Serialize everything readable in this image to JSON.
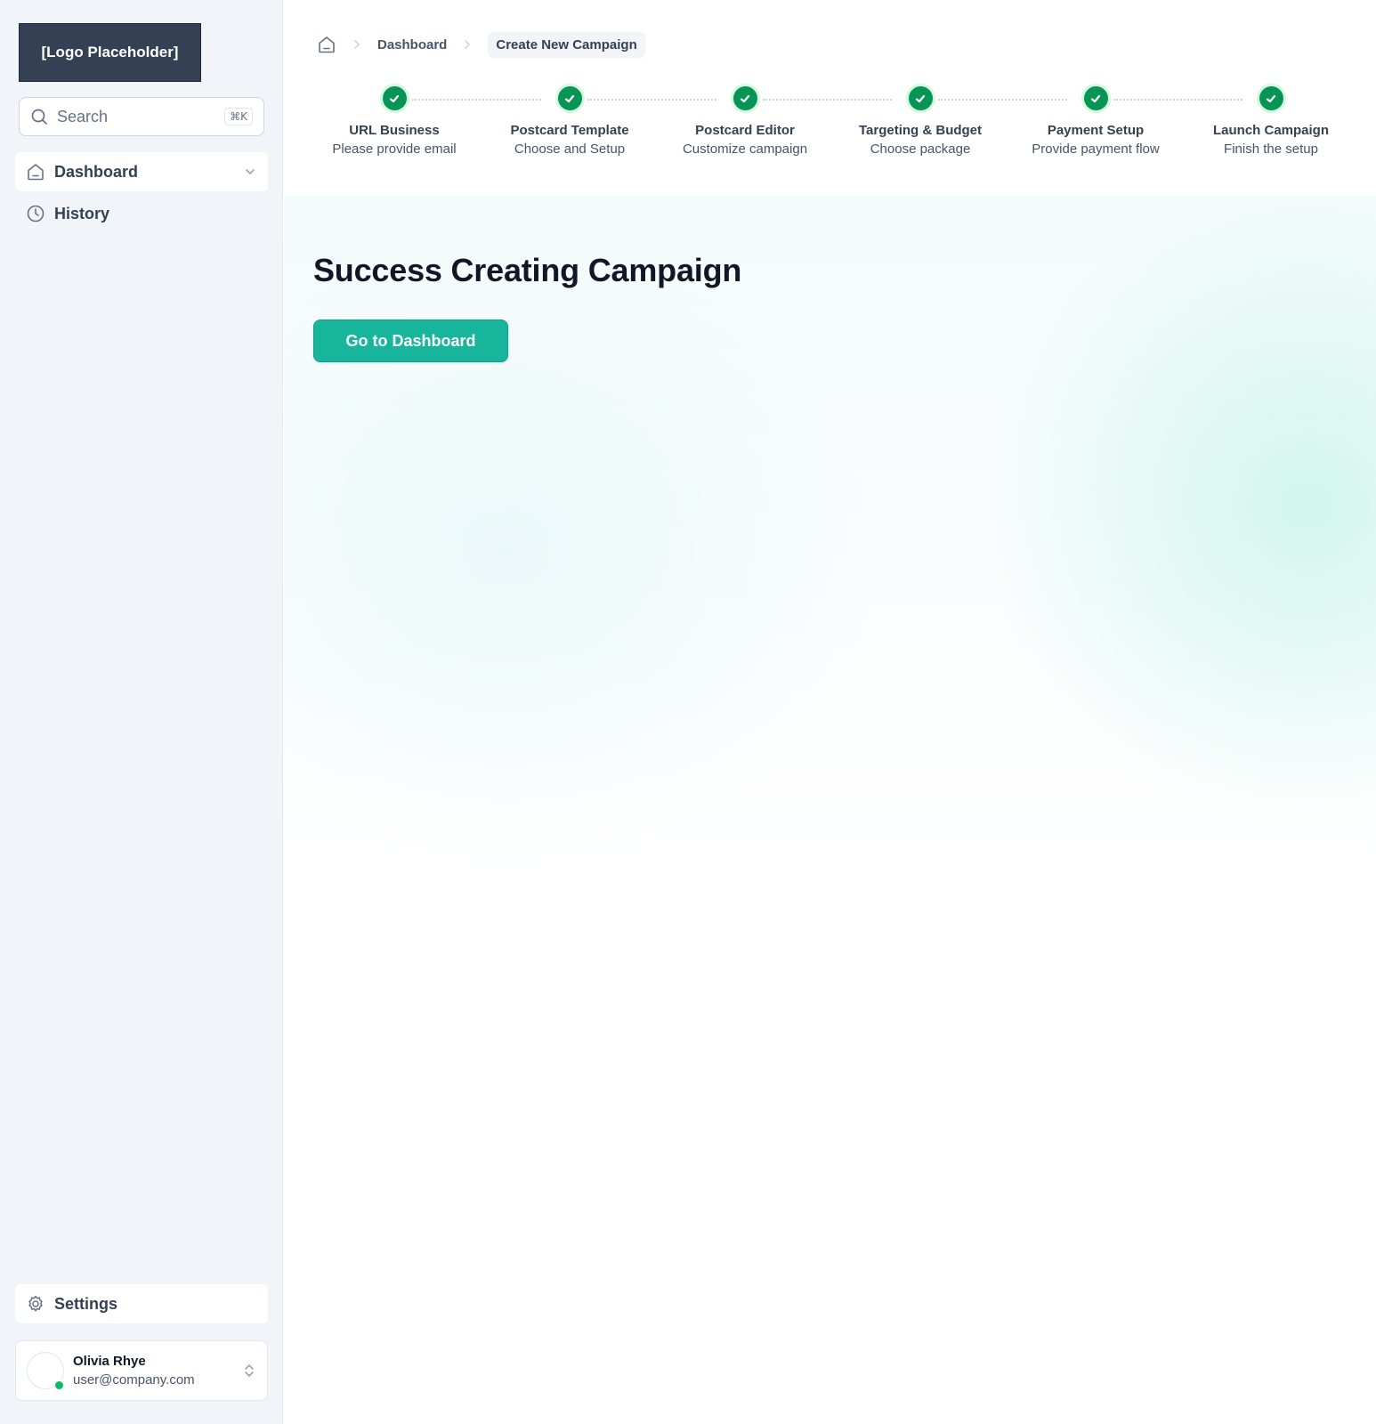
{
  "sidebar": {
    "logo_text": "[Logo Placeholder]",
    "search": {
      "placeholder": "Search",
      "shortcut": "⌘K"
    },
    "nav": [
      {
        "label": "Dashboard",
        "icon": "home-icon",
        "active": true,
        "expandable": true
      },
      {
        "label": "History",
        "icon": "clock-icon",
        "active": false
      }
    ],
    "settings_label": "Settings",
    "user": {
      "name": "Olivia Rhye",
      "email": "user@company.com",
      "status": "online"
    }
  },
  "breadcrumb": {
    "items": [
      "Dashboard",
      "Create New Campaign"
    ]
  },
  "stepper": {
    "steps": [
      {
        "title": "URL Business",
        "subtitle": "Please provide email",
        "status": "complete"
      },
      {
        "title": "Postcard Template",
        "subtitle": "Choose and Setup",
        "status": "complete"
      },
      {
        "title": "Postcard Editor",
        "subtitle": "Customize campaign",
        "status": "complete"
      },
      {
        "title": "Targeting & Budget",
        "subtitle": "Choose package",
        "status": "complete"
      },
      {
        "title": "Payment Setup",
        "subtitle": "Provide payment flow",
        "status": "complete"
      },
      {
        "title": "Launch Campaign",
        "subtitle": "Finish the setup",
        "status": "complete"
      }
    ]
  },
  "main": {
    "title": "Success Creating Campaign",
    "cta_label": "Go to Dashboard"
  },
  "colors": {
    "accent": "#17b69c",
    "success": "#079455",
    "logo_bg": "#344054",
    "sidebar_bg": "#f1f4f9"
  }
}
